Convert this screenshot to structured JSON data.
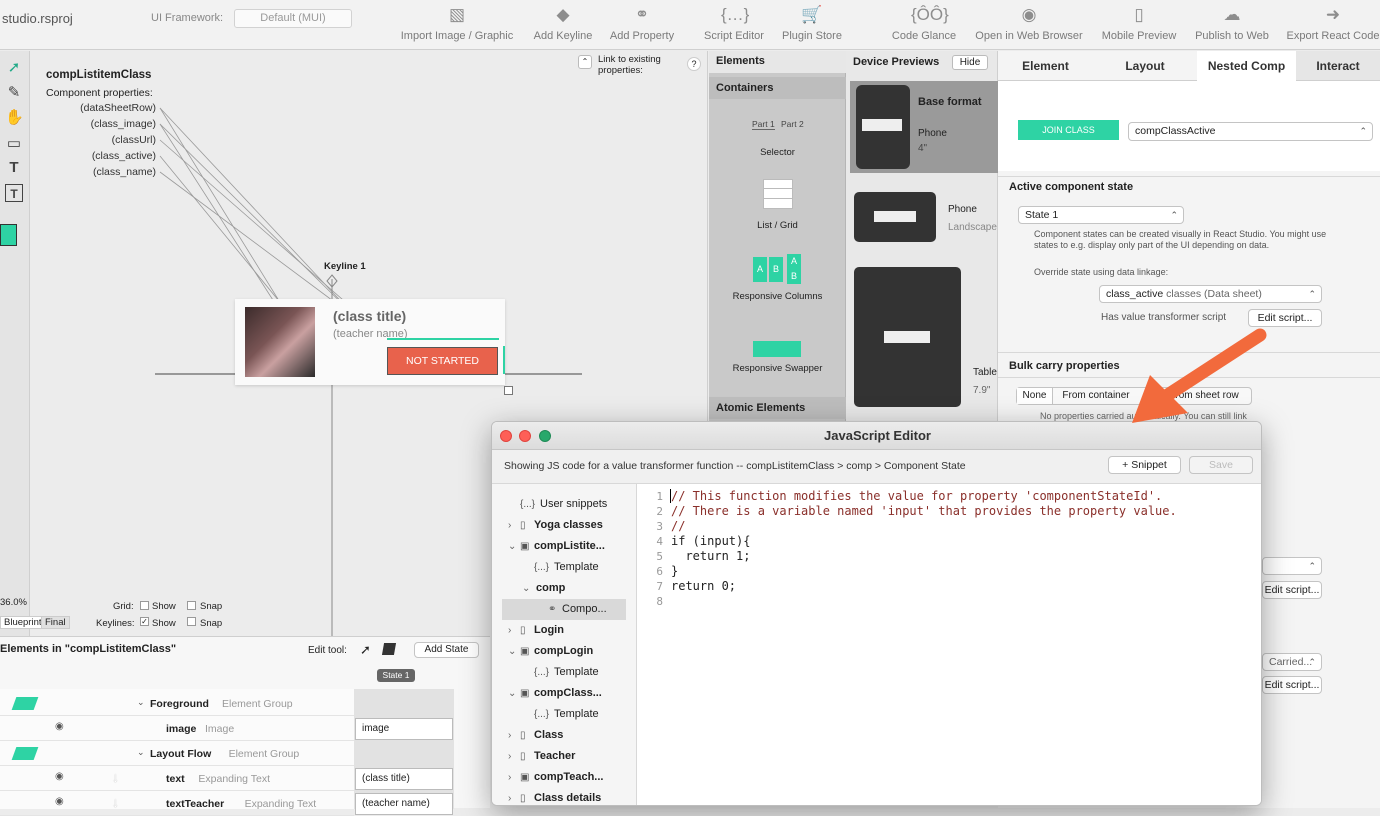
{
  "window": {
    "title": "studio.rsproj"
  },
  "toolbar": {
    "framework_label": "UI Framework:",
    "framework_value": "Default (MUI)",
    "buttons": [
      {
        "label": "Import Image / Graphic",
        "icon": "image-icon"
      },
      {
        "label": "Add Keyline",
        "icon": "keyline-icon"
      },
      {
        "label": "Add Property",
        "icon": "link-icon"
      },
      {
        "label": "Script Editor",
        "icon": "braces-icon"
      },
      {
        "label": "Plugin Store",
        "icon": "cart-icon"
      },
      {
        "label": "Code Glance",
        "icon": "binoculars-icon"
      },
      {
        "label": "Open in Web Browser",
        "icon": "globe-icon"
      },
      {
        "label": "Mobile Preview",
        "icon": "phone-icon"
      },
      {
        "label": "Publish to Web",
        "icon": "cloud-icon"
      },
      {
        "label": "Export React Code",
        "icon": "export-arrow-icon"
      }
    ]
  },
  "canvas": {
    "component_name": "compListitemClass",
    "props_label": "Component properties:",
    "props": [
      "(dataSheetRow)",
      "(class_image)",
      "(classUrl)",
      "(class_active)",
      "(class_name)"
    ],
    "link_existing": "Link to existing properties:",
    "help": "?",
    "keyline": "Keyline 1",
    "card_title": "(class title)",
    "card_teacher": "(teacher name)",
    "card_badge": "NOT STARTED",
    "zoom": "36.0%",
    "grid_label": "Grid:",
    "keylines_label": "Keylines:",
    "show": "Show",
    "snap": "Snap",
    "blueprint": "Blueprint",
    "final": "Final"
  },
  "elements_panel": {
    "title": "Elements",
    "containers": "Containers",
    "part1": "Part 1",
    "part2": "Part 2",
    "selector": "Selector",
    "list_grid": "List / Grid",
    "responsive_columns": "Responsive Columns",
    "responsive_swapper": "Responsive Swapper",
    "atomic": "Atomic Elements"
  },
  "device_previews": {
    "title": "Device Previews",
    "hide": "Hide",
    "base_format": "Base format",
    "phone": "Phone",
    "phone_size": "4\"",
    "phone2": "Phone",
    "landscape": "Landscape",
    "tablet": "Table",
    "tablet_size": "7.9\""
  },
  "inspector": {
    "tabs": [
      "Element",
      "Layout",
      "Nested Comp",
      "Interact"
    ],
    "join_class": "JOIN CLASS",
    "nested_comp_value": "compClassActive",
    "active_state_title": "Active component state",
    "state_value": "State 1",
    "state_help": "Component states can be created visually in React Studio. You might use states to e.g. display only part of the UI depending on data.",
    "override_label": "Override state using data linkage:",
    "linkage_value": "class_active",
    "linkage_source": "classes (Data sheet)",
    "transformer_label": "Has value transformer script",
    "edit_script": "Edit script...",
    "bulk_title": "Bulk carry properties",
    "bulk_none": "None",
    "bulk_container": "From container",
    "bulk_sheet": "From sheet row",
    "bulk_note": "No properties carried automatically. You can still link",
    "carried_value": "Carried...",
    "edit_script2": "Edit script...",
    "edit_script3": "Edit script..."
  },
  "bottom": {
    "title": "Elements in \"compListitemClass\"",
    "edit_tool": "Edit tool:",
    "add_state": "Add State",
    "state_badge": "State 1",
    "rows": [
      {
        "name": "Foreground",
        "type": "Element Group",
        "value": ""
      },
      {
        "name": "image",
        "type": "Image",
        "value": "image"
      },
      {
        "name": "Layout Flow",
        "type": "Element Group",
        "value": ""
      },
      {
        "name": "text",
        "type": "Expanding Text",
        "value": "(class title)"
      },
      {
        "name": "textTeacher",
        "type": "Expanding Text",
        "value": "(teacher name)"
      }
    ]
  },
  "js_editor": {
    "title": "JavaScript Editor",
    "subtitle": "Showing JS code for a value transformer function -- compListitemClass > comp > Component State",
    "snippet": "+ Snippet",
    "save": "Save",
    "tree": [
      {
        "label": "User snippets",
        "indent": 1,
        "icon": "{...}",
        "arrow": ""
      },
      {
        "label": "Yoga classes",
        "indent": 1,
        "icon": "▯",
        "arrow": "›",
        "bold": true
      },
      {
        "label": "compListite...",
        "indent": 1,
        "icon": "▣",
        "arrow": "⌄",
        "bold": true
      },
      {
        "label": "Template",
        "indent": 2,
        "icon": "{...}",
        "arrow": ""
      },
      {
        "label": "comp",
        "indent": 2,
        "icon": "",
        "arrow": "⌄",
        "bold": true
      },
      {
        "label": "Compo...",
        "indent": 3,
        "icon": "⚭",
        "arrow": "",
        "selected": true
      },
      {
        "label": "Login",
        "indent": 1,
        "icon": "▯",
        "arrow": "›",
        "bold": true
      },
      {
        "label": "compLogin",
        "indent": 1,
        "icon": "▣",
        "arrow": "⌄",
        "bold": true
      },
      {
        "label": "Template",
        "indent": 2,
        "icon": "{...}",
        "arrow": ""
      },
      {
        "label": "compClass...",
        "indent": 1,
        "icon": "▣",
        "arrow": "⌄",
        "bold": true
      },
      {
        "label": "Template",
        "indent": 2,
        "icon": "{...}",
        "arrow": ""
      },
      {
        "label": "Class",
        "indent": 1,
        "icon": "▯",
        "arrow": "›",
        "bold": true
      },
      {
        "label": "Teacher",
        "indent": 1,
        "icon": "▯",
        "arrow": "›",
        "bold": true
      },
      {
        "label": "compTeach...",
        "indent": 1,
        "icon": "▣",
        "arrow": "›",
        "bold": true
      },
      {
        "label": "Class details",
        "indent": 1,
        "icon": "▯",
        "arrow": "›",
        "bold": true
      }
    ],
    "code_lines": [
      {
        "n": "1",
        "text": "// This function modifies the value for property 'componentStateId'.",
        "comment": true
      },
      {
        "n": "2",
        "text": "// There is a variable named 'input' that provides the property value.",
        "comment": true
      },
      {
        "n": "3",
        "text": "//",
        "comment": true
      },
      {
        "n": "4",
        "text": "if (input){",
        "comment": false
      },
      {
        "n": "5",
        "text": "  return 1;",
        "comment": false
      },
      {
        "n": "6",
        "text": "}",
        "comment": false
      },
      {
        "n": "7",
        "text": "return 0;",
        "comment": false
      },
      {
        "n": "8",
        "text": "",
        "comment": false
      }
    ]
  },
  "colors": {
    "accent": "#2ed3a4",
    "badge": "#e8624c",
    "arrow": "#f26a3c"
  }
}
